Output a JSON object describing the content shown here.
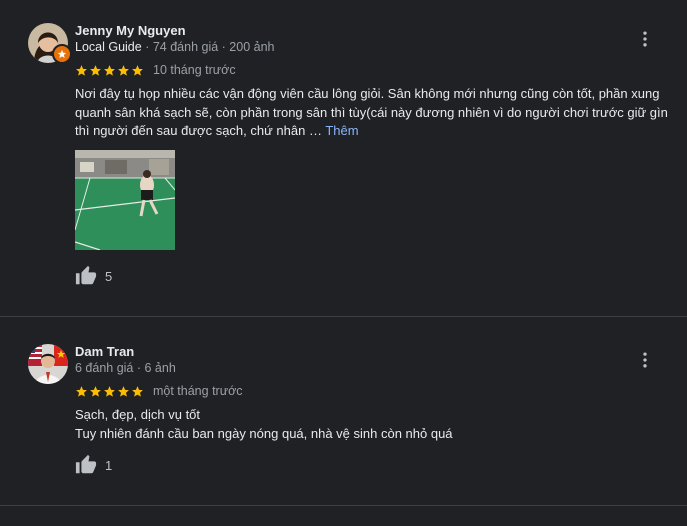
{
  "reviews": [
    {
      "author": "Jenny My Nguyen",
      "guide_label": "Local Guide",
      "meta": "· 74 đánh giá · 200 ảnh",
      "rating": 5,
      "time": "10 tháng trước",
      "text_lines": [
        "Nơi đây tụ họp nhiều các vận động viên cầu lông giỏi. Sân không mới nhưng cũng còn tốt, phần xung",
        "quanh sân khá sạch sẽ, còn phần trong sân thì tùy(cái này đương nhiên vì do người chơi trước giữ gìn",
        "thì người đến sau được sạch, chứ nhân …"
      ],
      "more_label": "Thêm",
      "likes": "5",
      "avatar_icon": "woman-avatar",
      "badge_icon": "local-guide-star-icon"
    },
    {
      "author": "Dam Tran",
      "meta": "6 đánh giá · 6 ảnh",
      "rating": 5,
      "time": "một tháng trước",
      "text_lines": [
        "Sạch, đẹp, dịch vụ tốt",
        "Tuy nhiên đánh cầu ban ngày nóng quá, nhà vệ sinh còn nhỏ quá"
      ],
      "likes": "1",
      "avatar_icon": "man-avatar-with-flags"
    }
  ],
  "colors": {
    "background": "#202124",
    "star": "#fbbc04",
    "link": "#8ab4f8",
    "badge": "#e8710a",
    "divider": "#3c4043"
  }
}
